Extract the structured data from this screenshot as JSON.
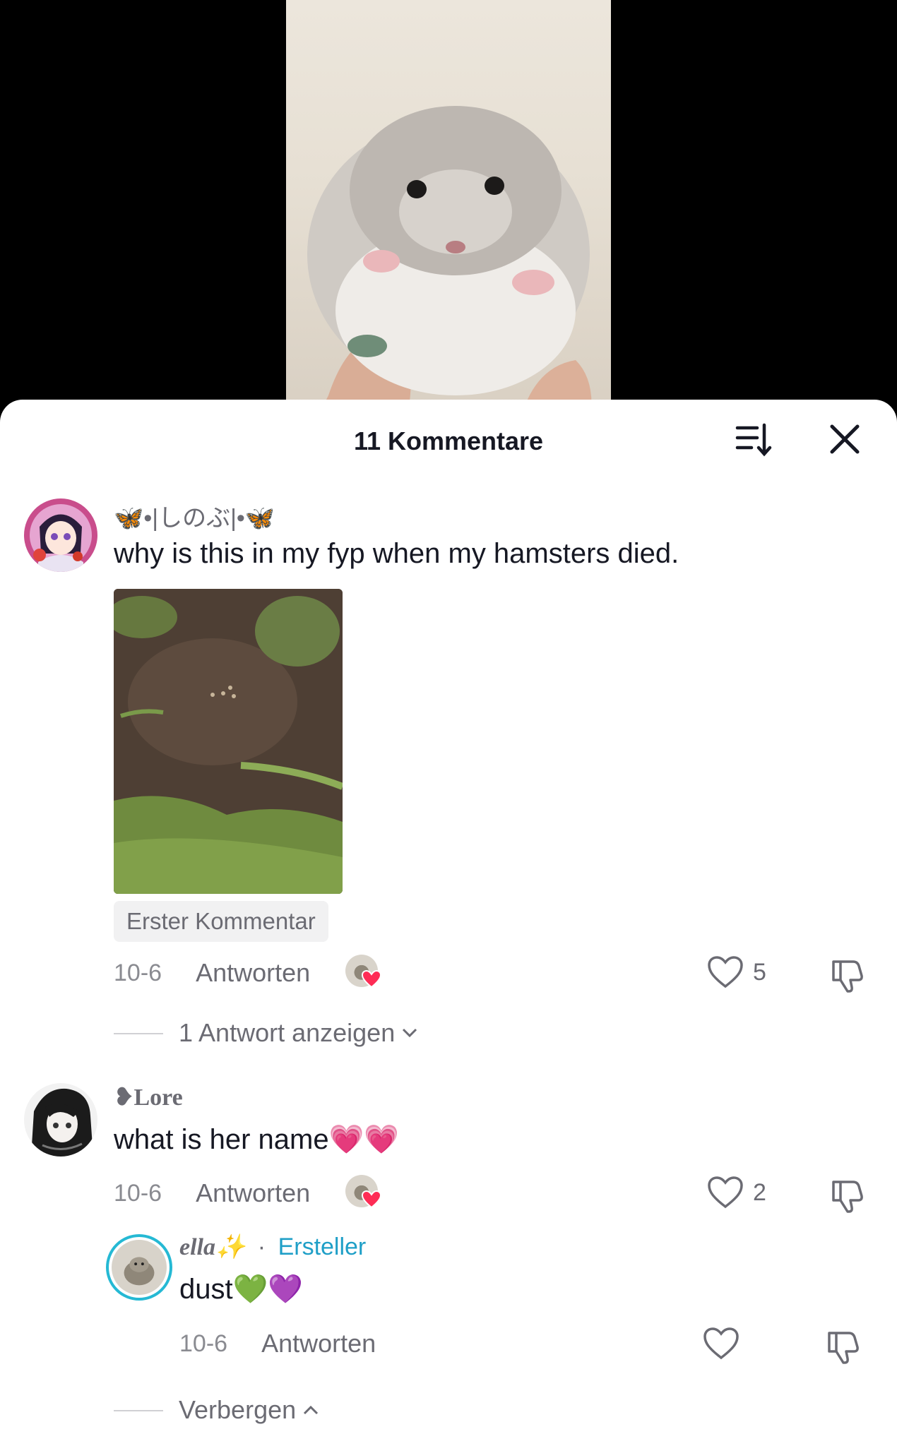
{
  "video": {
    "subject_icon": "hamster-image"
  },
  "sheet": {
    "title": "11 Kommentare",
    "sort_icon": "sort-icon",
    "close_icon": "close-icon"
  },
  "comments": [
    {
      "username": "🦋•|しのぶ|•🦋",
      "text": "why is this in my fyp when my hamsters died.",
      "has_image": true,
      "pill": "Erster Kommentar",
      "date": "10-6",
      "reply_label": "Antworten",
      "creator_liked": true,
      "likes": "5",
      "replies_toggle": "1 Antwort anzeigen"
    },
    {
      "username": "❥Lore",
      "text": "what is her name💗💗",
      "date": "10-6",
      "reply_label": "Antworten",
      "creator_liked": true,
      "likes": "2"
    }
  ],
  "reply": {
    "username": "ella✨",
    "separator": "·",
    "creator_label": "Ersteller",
    "text": "dust💚💜",
    "date": "10-6",
    "reply_label": "Antworten",
    "likes": ""
  },
  "hide_toggle": "Verbergen",
  "colors": {
    "text": "#161823",
    "muted": "#6b6b73",
    "creator": "#1f9fc7",
    "heart": "#fe2c55"
  }
}
